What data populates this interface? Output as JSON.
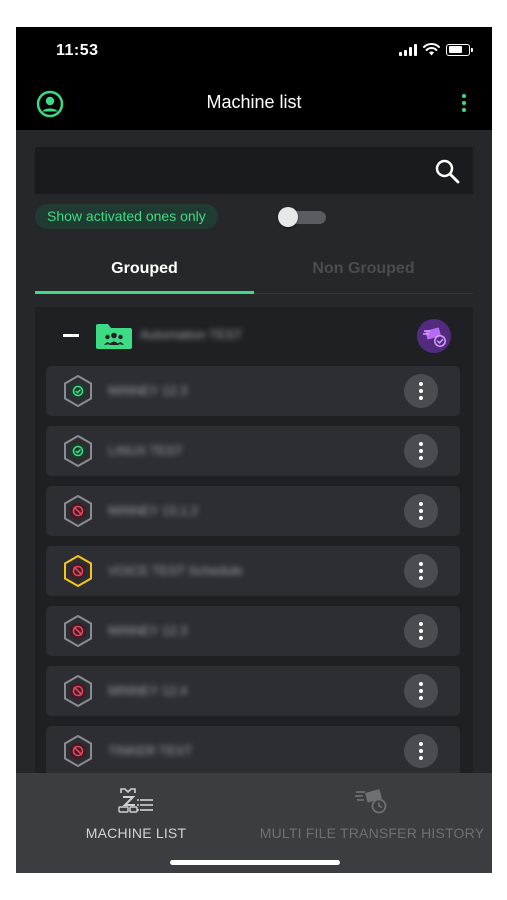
{
  "status_bar": {
    "time": "11:53"
  },
  "app_bar": {
    "title": "Machine list",
    "profile_icon": "account-circle-icon",
    "more_icon": "more-vert-icon"
  },
  "search": {
    "value": "",
    "placeholder": "",
    "icon": "search-icon"
  },
  "filter": {
    "chip_label": "Show activated ones only",
    "toggle_on": false
  },
  "tabs": [
    {
      "label": "Grouped",
      "active": true
    },
    {
      "label": "Non Grouped",
      "active": false
    }
  ],
  "group": {
    "name": "Automation TEST",
    "collapse_icon": "minus-icon",
    "folder_icon": "group-folder-icon",
    "badge_icon": "file-transfer-badge-icon"
  },
  "machines": [
    {
      "name": "MINNEY 12.3",
      "status": "active"
    },
    {
      "name": "LINUX TEST",
      "status": "active"
    },
    {
      "name": "MINNEY 13.1.2",
      "status": "inactive"
    },
    {
      "name": "VOICE TEST Schedule",
      "status": "warning"
    },
    {
      "name": "MINNEY 12.3",
      "status": "inactive"
    },
    {
      "name": "MINNEY 12.4",
      "status": "inactive"
    },
    {
      "name": "TINKER TEST",
      "status": "inactive"
    }
  ],
  "bottom_nav": [
    {
      "label": "MACHINE LIST",
      "icon": "machine-list-icon",
      "active": true
    },
    {
      "label": "MULTI FILE TRANSFER HISTORY",
      "icon": "transfer-history-icon",
      "active": false
    }
  ],
  "colors": {
    "accent": "#3ddc84",
    "background": "#25272b",
    "active_status": "#3ddc84",
    "inactive_status": "#e0455f",
    "warning_status": "#f5c518",
    "badge": "#522a7e"
  }
}
